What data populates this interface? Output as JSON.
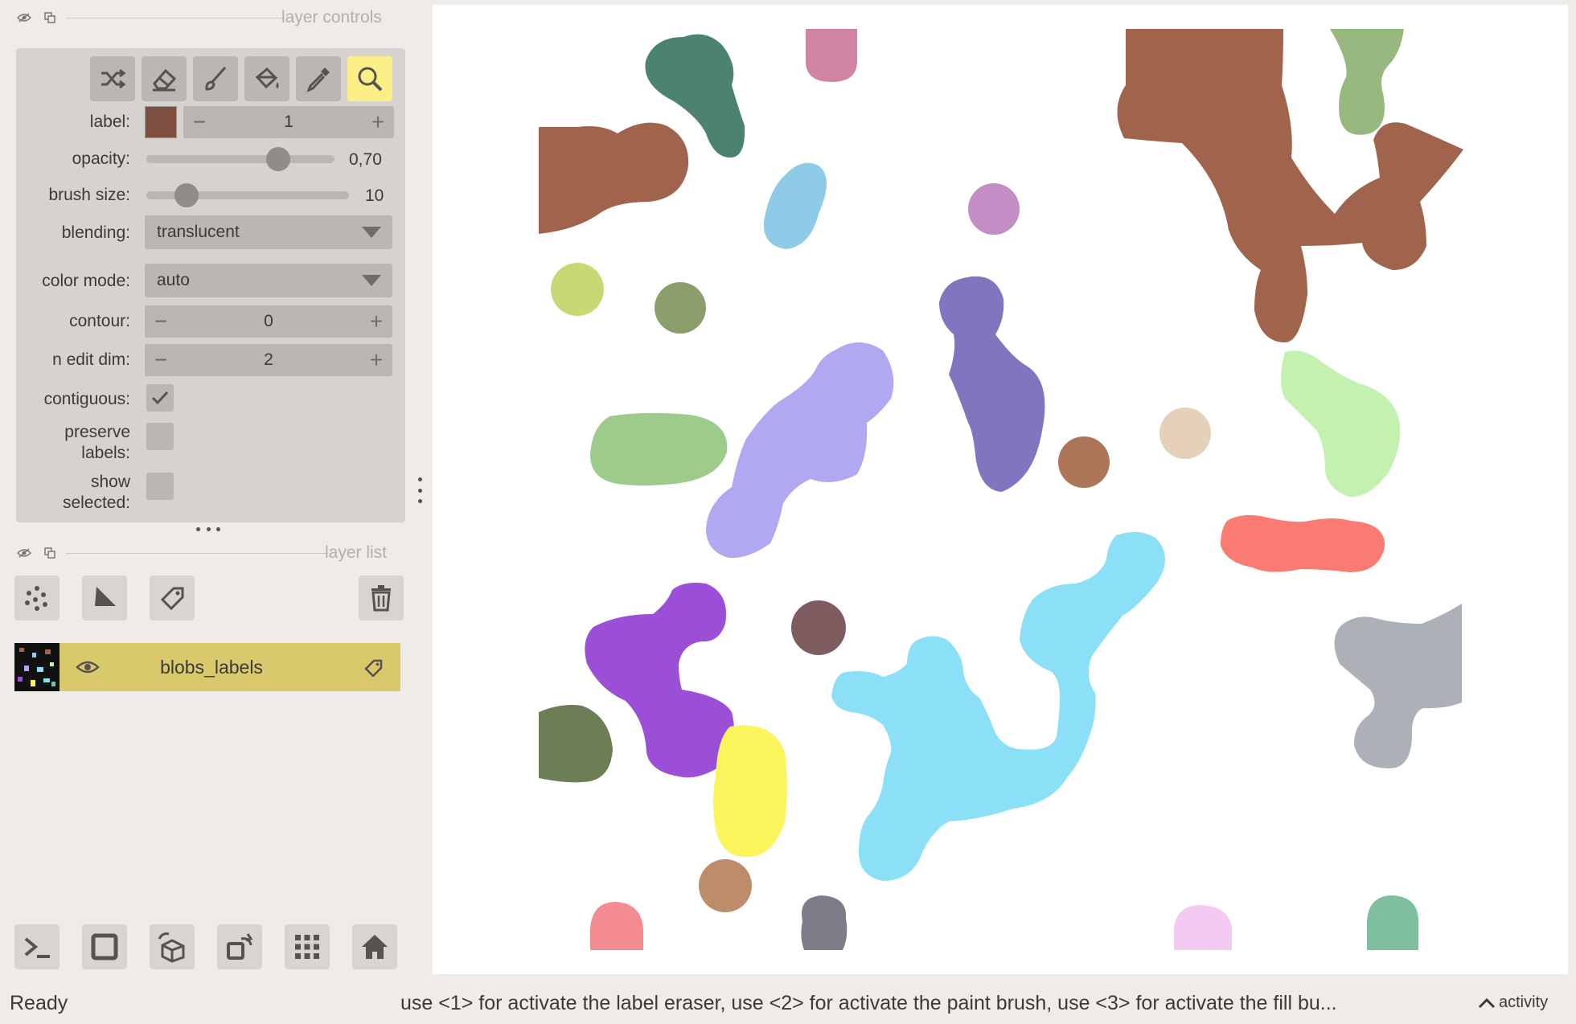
{
  "layer_controls": {
    "title": "layer controls"
  },
  "tools": [
    {
      "name": "shuffle-colors-icon"
    },
    {
      "name": "eraser-icon"
    },
    {
      "name": "paint-brush-icon"
    },
    {
      "name": "fill-bucket-icon"
    },
    {
      "name": "color-picker-icon"
    },
    {
      "name": "pan-zoom-icon"
    }
  ],
  "controls": {
    "label": {
      "label": "label:",
      "value": "1",
      "swatch": "#7f4f3f"
    },
    "opacity": {
      "label": "opacity:",
      "value": "0,70",
      "fraction": 0.7
    },
    "brush_size": {
      "label": "brush size:",
      "value": "10",
      "fraction": 0.2
    },
    "blending": {
      "label": "blending:",
      "value": "translucent"
    },
    "color_mode": {
      "label": "color mode:",
      "value": "auto"
    },
    "contour": {
      "label": "contour:",
      "value": "0"
    },
    "n_edit_dim": {
      "label": "n edit dim:",
      "value": "2"
    },
    "contiguous": {
      "label": "contiguous:",
      "checked": true
    },
    "preserve_labels": {
      "label_1": "preserve",
      "label_2": "labels:",
      "checked": false
    },
    "show_selected": {
      "label_1": "show",
      "label_2": "selected:",
      "checked": false
    }
  },
  "layer_list": {
    "title": "layer list",
    "layers": [
      {
        "name": "blobs_labels"
      }
    ]
  },
  "bottom_buttons": [
    {
      "name": "console-icon"
    },
    {
      "name": "square-icon"
    },
    {
      "name": "3d-cube-icon"
    },
    {
      "name": "roll-icon"
    },
    {
      "name": "grid-icon"
    },
    {
      "name": "home-icon"
    }
  ],
  "status": {
    "left": "Ready",
    "message": "use <1> for activate the label eraser, use <2> for activate the paint brush, use <3> for activate the fill bu...",
    "activity": "activity"
  },
  "colors": {
    "active_tool": "#fbee87",
    "layer_selected": "#d9c96c",
    "panel": "#d6d2ce"
  }
}
